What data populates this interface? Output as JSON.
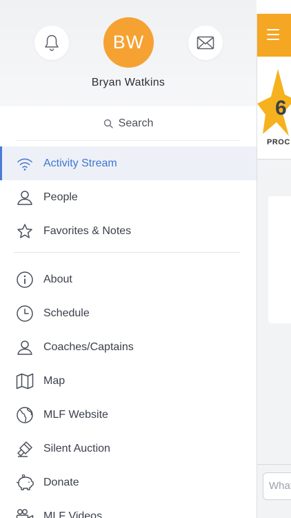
{
  "profile": {
    "initials": "BW",
    "name": "Bryan Watkins",
    "avatar_color": "#f5a233"
  },
  "search": {
    "label": "Search"
  },
  "menu_primary": [
    {
      "label": "Activity Stream",
      "icon": "wifi-icon",
      "active": true
    },
    {
      "label": "People",
      "icon": "person-icon"
    },
    {
      "label": "Favorites & Notes",
      "icon": "star-icon"
    }
  ],
  "menu_secondary": [
    {
      "label": "About",
      "icon": "info-icon"
    },
    {
      "label": "Schedule",
      "icon": "clock-icon"
    },
    {
      "label": "Coaches/Captains",
      "icon": "person-icon"
    },
    {
      "label": "Map",
      "icon": "map-icon"
    },
    {
      "label": "MLF Website",
      "icon": "globe-icon"
    },
    {
      "label": "Silent Auction",
      "icon": "gavel-icon"
    },
    {
      "label": "Donate",
      "icon": "piggy-bank-icon"
    },
    {
      "label": "MLF Videos",
      "icon": "video-camera-icon"
    }
  ],
  "peek": {
    "logo_text": "PROC",
    "logo_digit": "6",
    "input_placeholder": "What"
  },
  "colors": {
    "accent": "#3f74d4",
    "brand": "#f5a623"
  }
}
